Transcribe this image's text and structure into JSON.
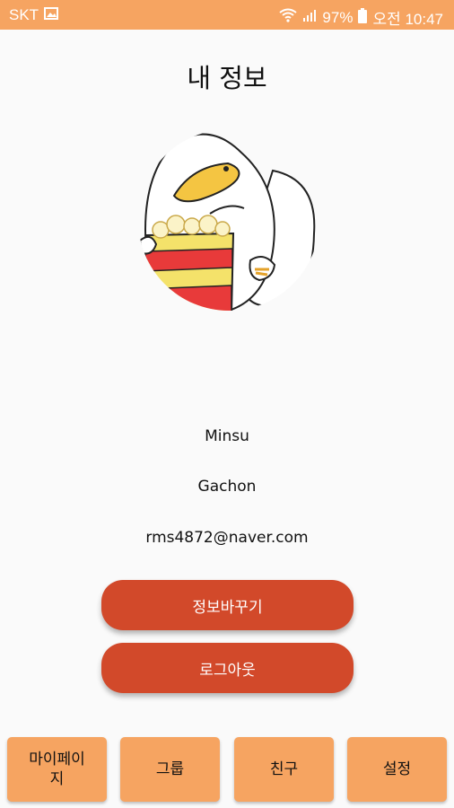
{
  "status_bar": {
    "carrier": "SKT",
    "battery": "97%",
    "time": "오전 10:47"
  },
  "page": {
    "title": "내 정보"
  },
  "profile": {
    "name": "Minsu",
    "school": "Gachon",
    "email": "rms4872@naver.com"
  },
  "actions": {
    "edit_label": "정보바꾸기",
    "logout_label": "로그아웃"
  },
  "bottom_nav": {
    "mypage": "마이페이\n지",
    "group": "그룹",
    "friends": "친구",
    "settings": "설정"
  },
  "colors": {
    "accent": "#f6a461",
    "button": "#d2492a"
  }
}
